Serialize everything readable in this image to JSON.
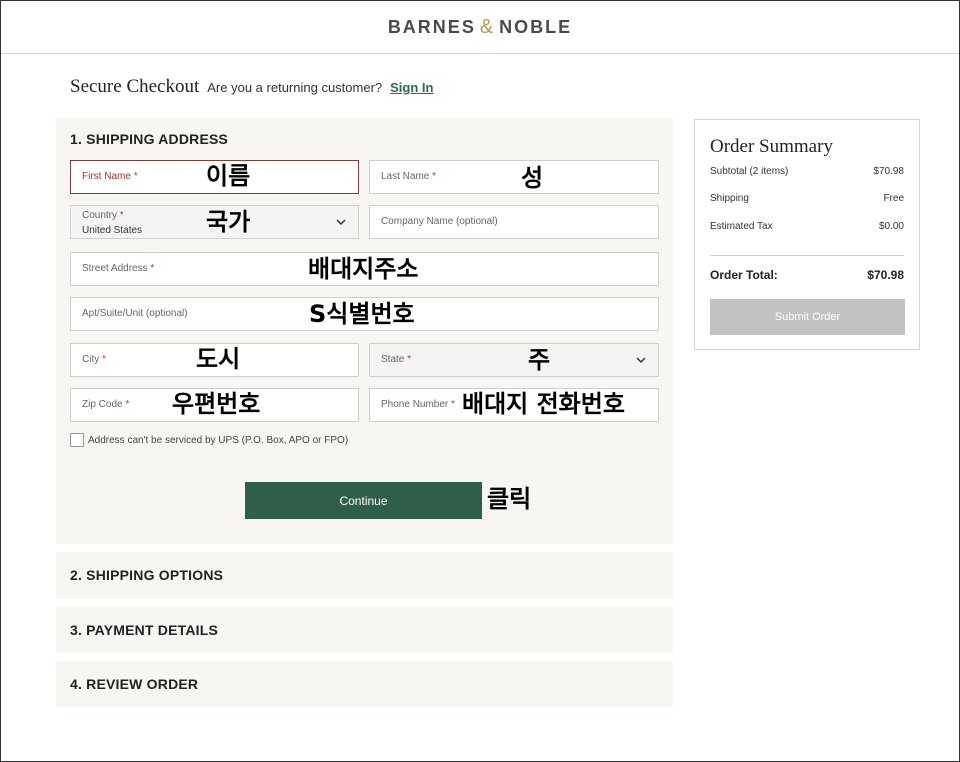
{
  "brand": {
    "left": "BARNES",
    "amp": "&",
    "right": "NOBLE"
  },
  "checkout": {
    "title": "Secure Checkout",
    "returning": "Are you a returning customer?",
    "signin": "Sign In"
  },
  "shipping": {
    "title": "1. SHIPPING ADDRESS",
    "required_mark": "*",
    "first_name_label": "First Name",
    "last_name_label": "Last Name",
    "country_label": "Country",
    "country_value": "United States",
    "company_label": "Company Name (optional)",
    "street_label": "Street Address",
    "apt_label": "Apt/Suite/Unit (optional)",
    "city_label": "City",
    "state_label": "State",
    "zip_label": "Zip Code",
    "phone_label": "Phone Number",
    "checkbox_label": "Address can't be serviced by UPS (P.O. Box, APO or FPO)",
    "continue_label": "Continue"
  },
  "annotations": {
    "first_name": "이름",
    "last_name": "성",
    "country": "국가",
    "street": "배대지주소",
    "apt": "S식별번호",
    "city": "도시",
    "state": "주",
    "zip": "우편번호",
    "phone": "배대지 전화번호",
    "continue": "클릭"
  },
  "sections": {
    "shipping_options": "2. SHIPPING OPTIONS",
    "payment_details": "3. PAYMENT DETAILS",
    "review_order": "4. REVIEW ORDER"
  },
  "summary": {
    "title": "Order Summary",
    "subtotal_label": "Subtotal (2 items)",
    "subtotal_value": "$70.98",
    "shipping_label": "Shipping",
    "shipping_value": "Free",
    "tax_label": "Estimated Tax",
    "tax_value": "$0.00",
    "total_label": "Order Total:",
    "total_value": "$70.98",
    "submit_label": "Submit Order"
  },
  "icons": {
    "select_chevron": "chevron-down-icon"
  },
  "colors": {
    "accent_green": "#2f5f4b",
    "link_green": "#2d6a4f",
    "brand_gold": "#b89a52",
    "required_red": "#c0392b"
  }
}
